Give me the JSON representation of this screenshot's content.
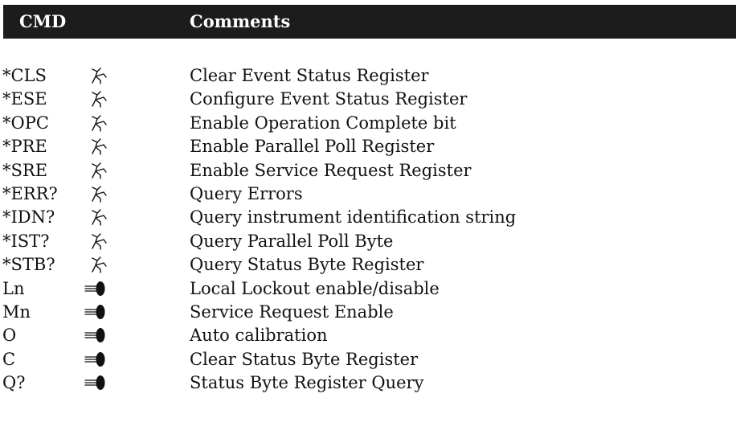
{
  "header": {
    "cmd_label": "CMD",
    "comments_label": "Comments"
  },
  "rows": [
    {
      "cmd": "*CLS",
      "icon": "ieee-common-command-icon",
      "comment": "Clear Event Status Register"
    },
    {
      "cmd": "*ESE",
      "icon": "ieee-common-command-icon",
      "comment": "Configure Event Status Register"
    },
    {
      "cmd": "*OPC",
      "icon": "ieee-common-command-icon",
      "comment": "Enable Operation Complete bit"
    },
    {
      "cmd": "*PRE",
      "icon": "ieee-common-command-icon",
      "comment": "Enable Parallel Poll Register"
    },
    {
      "cmd": "*SRE",
      "icon": "ieee-common-command-icon",
      "comment": "Enable Service Request Register"
    },
    {
      "cmd": "*ERR?",
      "icon": "ieee-common-command-icon",
      "comment": "Query Errors"
    },
    {
      "cmd": "*IDN?",
      "icon": "ieee-common-command-icon",
      "comment": "Query instrument identification string"
    },
    {
      "cmd": "*IST?",
      "icon": "ieee-common-command-icon",
      "comment": "Query Parallel Poll Byte"
    },
    {
      "cmd": "*STB?",
      "icon": "ieee-common-command-icon",
      "comment": "Query Status Byte Register"
    },
    {
      "cmd": "Ln",
      "icon": "device-command-icon",
      "comment": "Local Lockout enable/disable"
    },
    {
      "cmd": "Mn",
      "icon": "device-command-icon",
      "comment": "Service Request Enable"
    },
    {
      "cmd": "O",
      "icon": "device-command-icon",
      "comment": "Auto calibration"
    },
    {
      "cmd": "C",
      "icon": "device-command-icon",
      "comment": "Clear Status Byte Register"
    },
    {
      "cmd": "Q?",
      "icon": "device-command-icon",
      "comment": "Status Byte Register Query"
    }
  ]
}
